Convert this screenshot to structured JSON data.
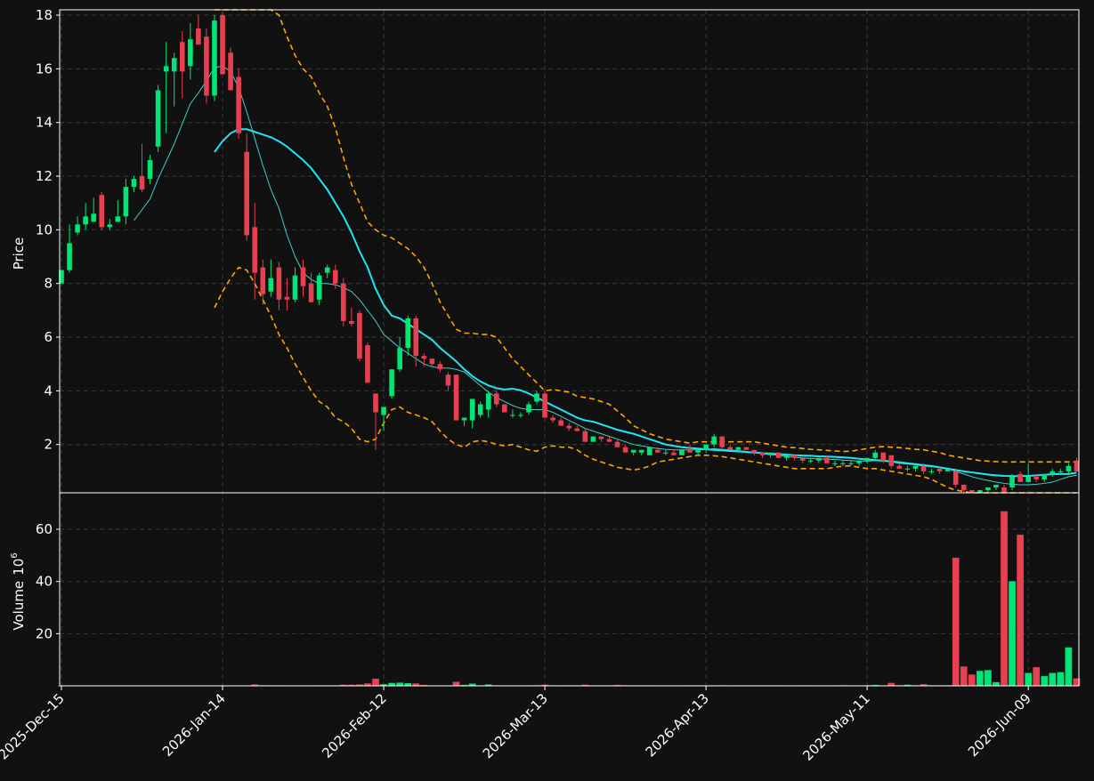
{
  "chart_data": {
    "type": "candlestick",
    "title": "",
    "price_panel": {
      "ylabel": "Price",
      "ylim": [
        0.2,
        18.2
      ],
      "yticks": [
        2,
        4,
        6,
        8,
        10,
        12,
        14,
        16,
        18
      ],
      "grid": true
    },
    "volume_panel": {
      "ylabel": "Volume",
      "ylabel_exponent": "10",
      "ylabel_exponent_power": "6",
      "ylim": [
        0,
        74
      ],
      "yticks": [
        20,
        40,
        60
      ],
      "grid": true
    },
    "x_tick_labels": [
      "2025-Dec-15",
      "2026-Jan-14",
      "2026-Feb-12",
      "2026-Mar-13",
      "2026-Apr-13",
      "2026-May-11",
      "2026-Jun-09"
    ],
    "x_tick_index": [
      0,
      20,
      40,
      60,
      80,
      100,
      120
    ],
    "colors": {
      "background": "#111111",
      "up": "#00e676",
      "down": "#e84050",
      "ma_fast": "#3fd0c9",
      "ma_slow": "#1ee6f5",
      "band": "#ffa500",
      "axis": "#ffffff",
      "grid": "#3a3a3a"
    },
    "candles": [
      [
        8.0,
        8.5,
        8.0,
        8.5
      ],
      [
        8.5,
        10.2,
        8.4,
        9.5
      ],
      [
        9.9,
        10.5,
        9.8,
        10.2
      ],
      [
        10.2,
        11.0,
        10.0,
        10.5
      ],
      [
        10.3,
        11.2,
        10.3,
        10.6
      ],
      [
        11.3,
        11.4,
        10.0,
        10.1
      ],
      [
        10.1,
        10.4,
        10.0,
        10.2
      ],
      [
        10.3,
        11.1,
        10.3,
        10.5
      ],
      [
        10.5,
        11.9,
        10.2,
        11.6
      ],
      [
        11.6,
        12.0,
        11.4,
        11.9
      ],
      [
        12.0,
        13.2,
        11.4,
        11.5
      ],
      [
        11.9,
        12.8,
        11.7,
        12.6
      ],
      [
        13.1,
        15.4,
        12.9,
        15.2
      ],
      [
        15.9,
        17.0,
        13.6,
        16.1
      ],
      [
        15.9,
        16.6,
        14.6,
        16.4
      ],
      [
        17.0,
        17.4,
        14.9,
        15.9
      ],
      [
        16.1,
        17.7,
        15.6,
        17.1
      ],
      [
        17.5,
        18.0,
        17.0,
        16.9
      ],
      [
        17.2,
        17.5,
        14.7,
        15.0
      ],
      [
        15.0,
        18.0,
        14.8,
        17.8
      ],
      [
        18.0,
        18.1,
        15.8,
        15.8
      ],
      [
        16.6,
        16.8,
        15.4,
        15.2
      ],
      [
        15.7,
        16.0,
        13.4,
        13.6
      ],
      [
        12.9,
        13.6,
        9.6,
        9.8
      ],
      [
        10.1,
        11.0,
        7.4,
        8.4
      ],
      [
        8.6,
        8.9,
        7.2,
        7.6
      ],
      [
        7.7,
        8.9,
        7.5,
        8.2
      ],
      [
        8.6,
        8.8,
        7.0,
        7.4
      ],
      [
        7.5,
        8.2,
        7.0,
        7.4
      ],
      [
        7.4,
        8.6,
        7.3,
        8.3
      ],
      [
        8.6,
        8.9,
        7.5,
        7.9
      ],
      [
        8.0,
        8.4,
        7.3,
        7.3
      ],
      [
        7.4,
        8.4,
        7.2,
        8.3
      ],
      [
        8.4,
        8.7,
        8.2,
        8.6
      ],
      [
        8.5,
        8.7,
        7.8,
        8.0
      ],
      [
        8.0,
        8.2,
        6.4,
        6.6
      ],
      [
        6.6,
        7.1,
        6.4,
        6.5
      ],
      [
        6.9,
        7.0,
        5.1,
        5.2
      ],
      [
        5.7,
        5.8,
        4.5,
        4.3
      ],
      [
        3.9,
        3.9,
        1.8,
        3.2
      ],
      [
        3.1,
        3.2,
        2.5,
        3.4
      ],
      [
        3.8,
        4.8,
        3.7,
        4.8
      ],
      [
        4.8,
        6.0,
        4.7,
        5.6
      ],
      [
        5.6,
        6.8,
        5.3,
        6.7
      ],
      [
        6.7,
        6.8,
        4.9,
        5.3
      ],
      [
        5.3,
        5.4,
        4.9,
        5.2
      ],
      [
        5.2,
        5.2,
        4.9,
        5.0
      ],
      [
        5.0,
        5.1,
        4.7,
        4.8
      ],
      [
        4.6,
        4.7,
        4.0,
        4.2
      ],
      [
        4.6,
        4.6,
        2.9,
        2.9
      ],
      [
        2.9,
        3.0,
        2.7,
        3.0
      ],
      [
        2.9,
        3.7,
        2.6,
        3.7
      ],
      [
        3.1,
        3.6,
        3.0,
        3.5
      ],
      [
        3.3,
        4.0,
        3.0,
        3.9
      ],
      [
        3.9,
        4.0,
        3.4,
        3.5
      ],
      [
        3.5,
        3.5,
        3.2,
        3.2
      ],
      [
        3.1,
        3.3,
        3.0,
        3.1
      ],
      [
        3.1,
        3.2,
        3.0,
        3.1
      ],
      [
        3.2,
        3.6,
        3.1,
        3.5
      ],
      [
        3.6,
        4.0,
        3.5,
        3.9
      ],
      [
        3.9,
        4.0,
        3.1,
        3.0
      ],
      [
        3.0,
        3.1,
        2.8,
        2.9
      ],
      [
        2.9,
        3.0,
        2.7,
        2.7
      ],
      [
        2.7,
        2.8,
        2.5,
        2.6
      ],
      [
        2.6,
        2.7,
        2.5,
        2.5
      ],
      [
        2.5,
        2.6,
        2.1,
        2.1
      ],
      [
        2.1,
        2.3,
        2.1,
        2.3
      ],
      [
        2.3,
        2.3,
        2.1,
        2.2
      ],
      [
        2.2,
        2.3,
        2.1,
        2.1
      ],
      [
        2.1,
        2.2,
        1.9,
        1.9
      ],
      [
        1.9,
        2.0,
        1.7,
        1.7
      ],
      [
        1.7,
        1.7,
        1.6,
        1.8
      ],
      [
        1.7,
        1.8,
        1.6,
        1.8
      ],
      [
        1.6,
        1.9,
        1.6,
        1.9
      ],
      [
        1.8,
        1.9,
        1.7,
        1.7
      ],
      [
        1.7,
        1.8,
        1.6,
        1.7
      ],
      [
        1.7,
        1.8,
        1.6,
        1.6
      ],
      [
        1.6,
        1.8,
        1.6,
        1.8
      ],
      [
        1.8,
        2.0,
        1.7,
        1.7
      ],
      [
        1.7,
        1.8,
        1.6,
        1.8
      ],
      [
        1.8,
        2.0,
        1.7,
        2.0
      ],
      [
        2.0,
        2.4,
        1.9,
        2.3
      ],
      [
        2.3,
        2.3,
        1.8,
        1.9
      ],
      [
        1.9,
        2.0,
        1.8,
        1.8
      ],
      [
        1.8,
        1.9,
        1.7,
        1.9
      ],
      [
        1.9,
        1.9,
        1.8,
        1.8
      ],
      [
        1.8,
        1.8,
        1.6,
        1.7
      ],
      [
        1.7,
        1.7,
        1.5,
        1.6
      ],
      [
        1.6,
        1.7,
        1.5,
        1.7
      ],
      [
        1.7,
        1.7,
        1.5,
        1.5
      ],
      [
        1.5,
        1.6,
        1.4,
        1.6
      ],
      [
        1.6,
        1.6,
        1.4,
        1.5
      ],
      [
        1.5,
        1.5,
        1.3,
        1.4
      ],
      [
        1.4,
        1.5,
        1.3,
        1.4
      ],
      [
        1.4,
        1.5,
        1.3,
        1.5
      ],
      [
        1.5,
        1.6,
        1.3,
        1.3
      ],
      [
        1.3,
        1.4,
        1.2,
        1.3
      ],
      [
        1.3,
        1.4,
        1.2,
        1.3
      ],
      [
        1.3,
        1.4,
        1.2,
        1.3
      ],
      [
        1.3,
        1.4,
        1.2,
        1.4
      ],
      [
        1.4,
        1.5,
        1.3,
        1.5
      ],
      [
        1.5,
        1.8,
        1.4,
        1.7
      ],
      [
        1.7,
        1.7,
        1.3,
        1.4
      ],
      [
        1.6,
        1.6,
        1.1,
        1.2
      ],
      [
        1.2,
        1.3,
        1.1,
        1.1
      ],
      [
        1.1,
        1.2,
        1.0,
        1.1
      ],
      [
        1.1,
        1.2,
        1.0,
        1.2
      ],
      [
        1.2,
        1.3,
        0.9,
        1.0
      ],
      [
        1.0,
        1.1,
        0.9,
        1.0
      ],
      [
        1.1,
        1.2,
        0.9,
        1.0
      ],
      [
        1.0,
        1.1,
        1.0,
        1.1
      ],
      [
        1.0,
        1.1,
        0.4,
        0.5
      ],
      [
        0.5,
        0.5,
        0.2,
        0.3
      ],
      [
        0.3,
        0.3,
        0.2,
        0.2
      ],
      [
        0.2,
        0.3,
        0.2,
        0.3
      ],
      [
        0.3,
        0.4,
        0.2,
        0.4
      ],
      [
        0.4,
        0.5,
        0.3,
        0.5
      ],
      [
        0.4,
        0.5,
        0.2,
        0.2
      ],
      [
        0.4,
        0.9,
        0.3,
        0.8
      ],
      [
        0.9,
        1.0,
        0.6,
        0.6
      ],
      [
        0.6,
        1.3,
        0.6,
        0.8
      ],
      [
        0.8,
        0.9,
        0.6,
        0.7
      ],
      [
        0.7,
        0.9,
        0.6,
        0.9
      ],
      [
        0.9,
        1.1,
        0.8,
        1.0
      ],
      [
        1.0,
        1.1,
        0.9,
        1.0
      ],
      [
        1.0,
        1.3,
        0.9,
        1.2
      ],
      [
        1.4,
        1.5,
        1.0,
        1.0
      ]
    ],
    "volume": [
      0.1,
      0.1,
      0.1,
      0.1,
      0.1,
      0.1,
      0.1,
      0.1,
      0.1,
      0.1,
      0.1,
      0.1,
      0.1,
      0.1,
      0.1,
      0.1,
      0.1,
      0.1,
      0.1,
      0.1,
      0.1,
      0.1,
      0.1,
      0.1,
      0.6,
      0.3,
      0.2,
      0.2,
      0.1,
      0.1,
      0.1,
      0.1,
      0.2,
      0.2,
      0.2,
      0.5,
      0.5,
      0.6,
      1.0,
      2.8,
      0.7,
      1.2,
      1.3,
      1.1,
      1.0,
      0.4,
      0.1,
      0.1,
      0.1,
      1.6,
      0.4,
      0.9,
      0.2,
      0.6,
      0.2,
      0.1,
      0.1,
      0.1,
      0.1,
      0.3,
      0.5,
      0.3,
      0.2,
      0.3,
      0.2,
      0.5,
      0.2,
      0.2,
      0.2,
      0.4,
      0.3,
      0.1,
      0.2,
      0.2,
      0.1,
      0.1,
      0.1,
      0.1,
      0.2,
      0.2,
      0.2,
      0.1,
      0.3,
      0.1,
      0.2,
      0.2,
      0.2,
      0.1,
      0.2,
      0.2,
      0.1,
      0.1,
      0.2,
      0.1,
      0.1,
      0.1,
      0.1,
      0.3,
      0.1,
      0.1,
      0.3,
      0.4,
      0.2,
      1.2,
      0.3,
      0.5,
      0.3,
      0.7,
      0.3,
      0.2,
      0.3,
      49.2,
      7.5,
      4.4,
      5.8,
      6.1,
      1.5,
      67.0,
      40.2,
      58.0,
      5.0,
      7.2,
      3.8,
      5.0,
      5.3,
      14.8,
      2.9
    ],
    "ma_fast": [
      null,
      null,
      null,
      null,
      null,
      null,
      null,
      null,
      null,
      10.35,
      10.75,
      11.15,
      11.9,
      12.55,
      13.2,
      13.95,
      14.7,
      15.1,
      15.55,
      16.05,
      16.1,
      15.9,
      15.3,
      14.4,
      13.4,
      12.4,
      11.5,
      10.8,
      9.8,
      9.0,
      8.4,
      8.15,
      8.0,
      8.0,
      7.95,
      7.85,
      7.7,
      7.4,
      7.0,
      6.6,
      6.1,
      5.85,
      5.6,
      5.4,
      5.2,
      5.0,
      4.9,
      4.85,
      4.85,
      4.8,
      4.7,
      4.45,
      4.2,
      3.95,
      3.75,
      3.6,
      3.45,
      3.35,
      3.3,
      3.3,
      3.3,
      3.2,
      3.05,
      2.9,
      2.75,
      2.6,
      2.5,
      2.4,
      2.3,
      2.2,
      2.1,
      2.0,
      1.95,
      1.9,
      1.85,
      1.82,
      1.8,
      1.8,
      1.8,
      1.8,
      1.82,
      1.84,
      1.82,
      1.8,
      1.77,
      1.74,
      1.7,
      1.66,
      1.62,
      1.6,
      1.55,
      1.52,
      1.5,
      1.48,
      1.46,
      1.45,
      1.44,
      1.42,
      1.4,
      1.38,
      1.38,
      1.4,
      1.38,
      1.35,
      1.3,
      1.27,
      1.24,
      1.2,
      1.17,
      1.14,
      1.1,
      1.0,
      0.9,
      0.8,
      0.72,
      0.66,
      0.6,
      0.55,
      0.52,
      0.5,
      0.5,
      0.52,
      0.55,
      0.6,
      0.7,
      0.8,
      0.85
    ],
    "ma_slow": [
      null,
      null,
      null,
      null,
      null,
      null,
      null,
      null,
      null,
      null,
      null,
      null,
      null,
      null,
      null,
      null,
      null,
      null,
      null,
      12.9,
      13.3,
      13.6,
      13.75,
      13.75,
      13.65,
      13.55,
      13.45,
      13.3,
      13.1,
      12.85,
      12.6,
      12.3,
      11.9,
      11.5,
      11.0,
      10.5,
      9.9,
      9.2,
      8.6,
      7.8,
      7.2,
      6.8,
      6.7,
      6.5,
      6.3,
      6.1,
      5.9,
      5.6,
      5.35,
      5.1,
      4.8,
      4.55,
      4.35,
      4.2,
      4.1,
      4.05,
      4.08,
      4.02,
      3.9,
      3.75,
      3.6,
      3.45,
      3.3,
      3.15,
      3.0,
      2.9,
      2.85,
      2.75,
      2.65,
      2.55,
      2.47,
      2.4,
      2.3,
      2.2,
      2.1,
      2.0,
      1.95,
      1.9,
      1.87,
      1.85,
      1.82,
      1.8,
      1.78,
      1.76,
      1.74,
      1.72,
      1.7,
      1.68,
      1.66,
      1.64,
      1.62,
      1.6,
      1.59,
      1.58,
      1.56,
      1.55,
      1.54,
      1.52,
      1.5,
      1.47,
      1.44,
      1.42,
      1.4,
      1.37,
      1.34,
      1.3,
      1.27,
      1.23,
      1.2,
      1.15,
      1.1,
      1.05,
      1.0,
      0.96,
      0.92,
      0.88,
      0.85,
      0.83,
      0.82,
      0.82,
      0.83,
      0.85,
      0.87,
      0.89,
      0.9,
      0.9,
      0.95
    ],
    "band_upper": [
      null,
      null,
      null,
      null,
      null,
      null,
      null,
      null,
      null,
      null,
      null,
      null,
      null,
      null,
      null,
      null,
      null,
      null,
      null,
      30.0,
      28.0,
      26.0,
      24.0,
      22.5,
      21.0,
      19.5,
      18.7,
      18.0,
      17.2,
      16.5,
      16.0,
      15.7,
      15.1,
      14.6,
      13.8,
      12.7,
      11.7,
      11.0,
      10.3,
      10.0,
      9.8,
      9.7,
      9.5,
      9.3,
      9.0,
      8.6,
      8.0,
      7.3,
      6.8,
      6.3,
      6.15,
      6.15,
      6.1,
      6.1,
      6.0,
      5.6,
      5.2,
      4.9,
      4.6,
      4.3,
      4.0,
      4.05,
      4.0,
      3.95,
      3.8,
      3.75,
      3.7,
      3.6,
      3.5,
      3.25,
      3.0,
      2.7,
      2.55,
      2.4,
      2.3,
      2.2,
      2.15,
      2.1,
      2.05,
      2.1,
      2.1,
      2.1,
      2.1,
      2.1,
      2.1,
      2.1,
      2.1,
      2.05,
      2.0,
      1.95,
      1.9,
      1.88,
      1.85,
      1.82,
      1.8,
      1.78,
      1.76,
      1.74,
      1.75,
      1.8,
      1.85,
      1.9,
      1.92,
      1.9,
      1.88,
      1.85,
      1.82,
      1.8,
      1.75,
      1.7,
      1.6,
      1.55,
      1.5,
      1.45,
      1.4,
      1.38,
      1.36,
      1.35,
      1.35,
      1.35,
      1.35,
      1.35,
      1.35,
      1.35,
      1.35,
      1.35,
      1.35
    ],
    "band_lower": [
      null,
      null,
      null,
      null,
      null,
      null,
      null,
      null,
      null,
      null,
      null,
      null,
      null,
      null,
      null,
      null,
      null,
      null,
      null,
      7.1,
      7.7,
      8.2,
      8.6,
      8.5,
      8.0,
      7.4,
      6.8,
      6.1,
      5.6,
      5.0,
      4.5,
      4.0,
      3.6,
      3.4,
      3.0,
      2.85,
      2.6,
      2.2,
      2.1,
      2.2,
      2.8,
      3.3,
      3.4,
      3.2,
      3.1,
      3.0,
      2.85,
      2.5,
      2.2,
      2.0,
      1.9,
      2.1,
      2.15,
      2.1,
      2.0,
      1.95,
      2.0,
      1.9,
      1.8,
      1.75,
      1.9,
      1.95,
      1.9,
      1.9,
      1.8,
      1.6,
      1.45,
      1.35,
      1.25,
      1.15,
      1.1,
      1.05,
      1.1,
      1.2,
      1.35,
      1.4,
      1.45,
      1.5,
      1.55,
      1.6,
      1.6,
      1.58,
      1.55,
      1.5,
      1.45,
      1.4,
      1.35,
      1.3,
      1.25,
      1.2,
      1.15,
      1.1,
      1.1,
      1.1,
      1.1,
      1.1,
      1.15,
      1.2,
      1.2,
      1.15,
      1.1,
      1.1,
      1.05,
      1.0,
      0.95,
      0.9,
      0.85,
      0.8,
      0.7,
      0.55,
      0.4,
      0.3,
      0.25,
      0.2,
      0.2,
      0.2,
      0.2,
      0.2,
      0.2,
      0.2,
      0.2,
      0.2,
      0.2,
      0.2,
      0.2,
      0.2,
      0.2
    ]
  }
}
